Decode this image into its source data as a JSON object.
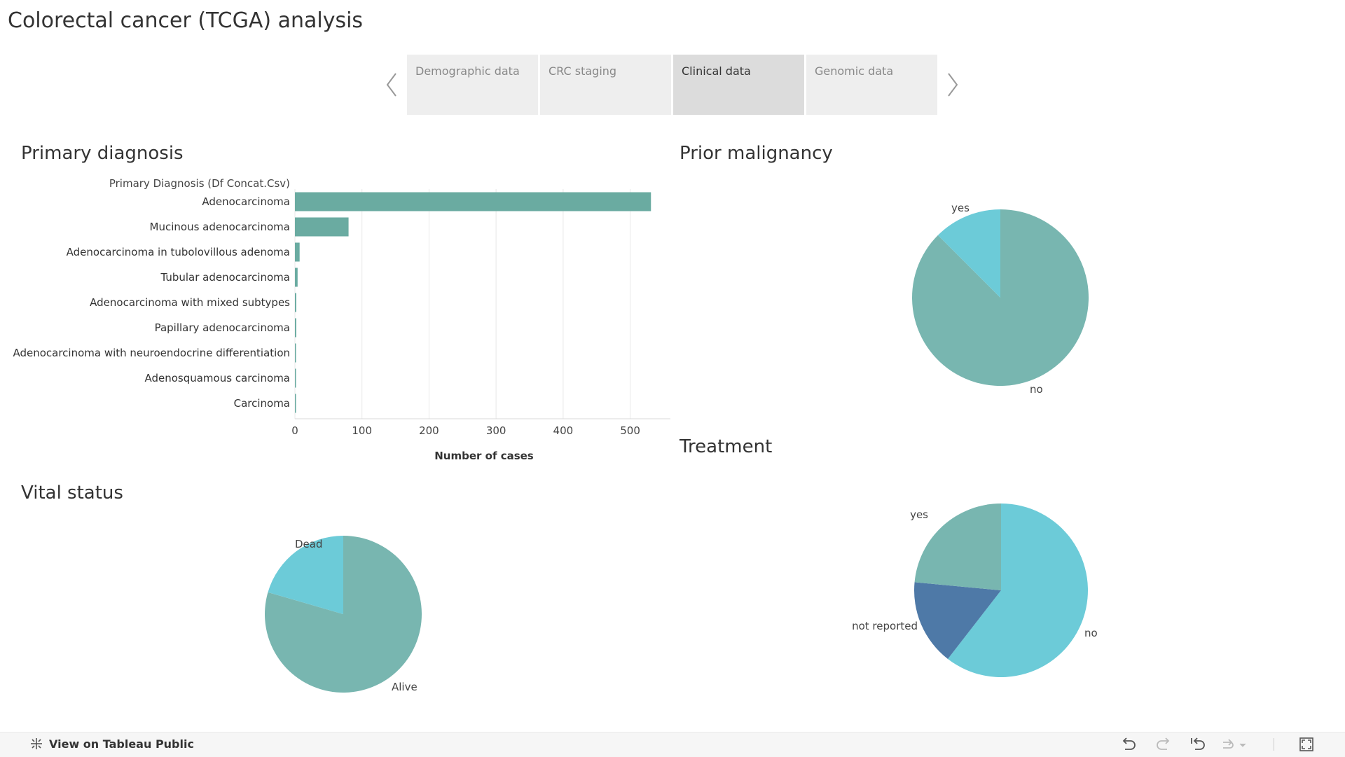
{
  "page": {
    "title": "Colorectal cancer (TCGA) analysis"
  },
  "tabs": [
    {
      "label": "Demographic data",
      "active": false
    },
    {
      "label": "CRC staging",
      "active": false
    },
    {
      "label": "Clinical data",
      "active": true
    },
    {
      "label": "Genomic data",
      "active": false
    }
  ],
  "sections": {
    "primary_diagnosis": "Primary diagnosis",
    "prior_malignancy": "Prior malignancy",
    "vital_status": "Vital status",
    "treatment": "Treatment"
  },
  "chart_data": [
    {
      "type": "bar",
      "orientation": "horizontal",
      "category_header": "Primary Diagnosis (Df Concat.Csv)",
      "categories": [
        "Adenocarcinoma",
        "Mucinous adenocarcinoma",
        "Adenocarcinoma in tubolovillous adenoma",
        "Tubular adenocarcinoma",
        "Adenocarcinoma with mixed subtypes",
        "Papillary adenocarcinoma",
        "Adenocarcinoma with neuroendocrine differentiation",
        "Adenosquamous carcinoma",
        "Carcinoma"
      ],
      "values": [
        531,
        80,
        7,
        4,
        2,
        2,
        1,
        1,
        1
      ],
      "xlabel": "Number of cases",
      "xlim": [
        0,
        560
      ],
      "xticks": [
        0,
        100,
        200,
        300,
        400,
        500
      ],
      "grid": true,
      "color": "#6aaba1"
    },
    {
      "type": "pie",
      "labels": [
        "no",
        "yes"
      ],
      "values": [
        87.5,
        12.5
      ],
      "colors": [
        "#78b6b0",
        "#6ccbd8"
      ]
    },
    {
      "type": "pie",
      "labels": [
        "Alive",
        "Dead"
      ],
      "values": [
        79.5,
        20.5
      ],
      "colors": [
        "#78b6b0",
        "#6ccbd8"
      ]
    },
    {
      "type": "pie",
      "labels": [
        "no",
        "not reported",
        "yes"
      ],
      "values": [
        60.5,
        16.0,
        23.5
      ],
      "colors": [
        "#6ccbd8",
        "#4e79a7",
        "#78b6b0"
      ]
    }
  ],
  "footer": {
    "link_label": "View on Tableau Public",
    "icons": [
      "undo-icon",
      "redo-icon",
      "revert-icon",
      "refresh-icon",
      "fullscreen-icon"
    ]
  }
}
